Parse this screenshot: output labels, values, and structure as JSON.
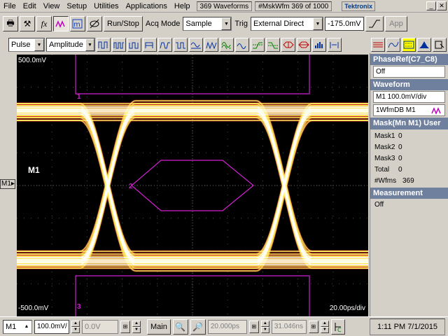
{
  "menu": {
    "items": [
      "File",
      "Edit",
      "View",
      "Setup",
      "Utilities",
      "Applications",
      "Help"
    ],
    "waveforms": "369 Waveforms",
    "mask_count": "#MskWfm  369 of 1000",
    "brand": "Tektronix"
  },
  "toolbar": {
    "run_stop": "Run/Stop",
    "acq_mode_label": "Acq Mode",
    "acq_mode_value": "Sample",
    "trig_label": "Trig",
    "trig_value": "External Direct",
    "trig_level": "-175.0mV",
    "apply": "App"
  },
  "meas_toolbar": {
    "source": "Pulse",
    "measurement": "Amplitude"
  },
  "graticule": {
    "top_level": "500.0mV",
    "bottom_level": "-500.0mV",
    "timebase": "20.00ps/div",
    "channel": "M1",
    "mask1": "1",
    "mask2": "2",
    "mask3": "3",
    "colors": {
      "mask": "#d020d0",
      "trace_hot": "#ffffff",
      "trace_mid": "#ffff60",
      "trace_low": "#ff3030"
    }
  },
  "panel": {
    "phaseref_title": "PhaseRef(C7_C8)",
    "phaseref_value": "Off",
    "waveform_title": "Waveform",
    "waveform_scale": "M1 100.0mV/div",
    "waveform_db": "1WfmDB M1",
    "mask_title": "Mask(Mn M1) User",
    "mask_rows": [
      {
        "k": "Mask1",
        "v": "0"
      },
      {
        "k": "Mask2",
        "v": "0"
      },
      {
        "k": "Mask3",
        "v": "0"
      },
      {
        "k": "Total",
        "v": "0"
      },
      {
        "k": "#Wfms",
        "v": "369"
      }
    ],
    "measurement_title": "Measurement",
    "measurement_value": "Off"
  },
  "bottom": {
    "channel": "M1",
    "scale": "100.0mV/",
    "offset": "0.0V",
    "main": "Main",
    "horiz_scale": "20.000ps",
    "horiz_pos": "31.046ns",
    "clock": "1:11 PM 7/1/2015"
  }
}
